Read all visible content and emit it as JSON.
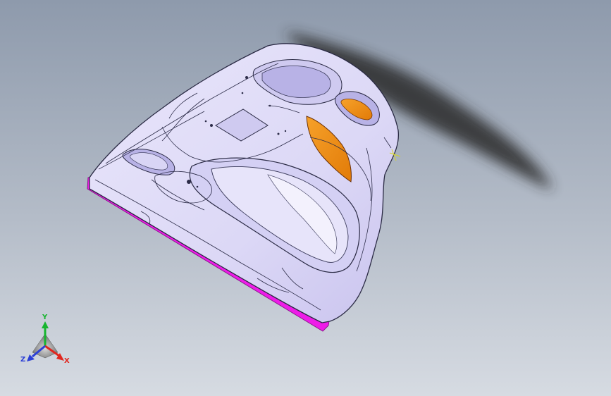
{
  "viewport": {
    "background_top": "#8e9aac",
    "background_bottom": "#d6dbe2",
    "part_color": "#dcd8f6",
    "accent_flange": "#ee1ce8",
    "accent_pocket": "#f28a12"
  },
  "triad": {
    "y_label": "Y",
    "x_label": "X",
    "z_label": "Z",
    "y_color": "#16b52e",
    "x_color": "#e0261e",
    "z_color": "#2b3fd6"
  }
}
